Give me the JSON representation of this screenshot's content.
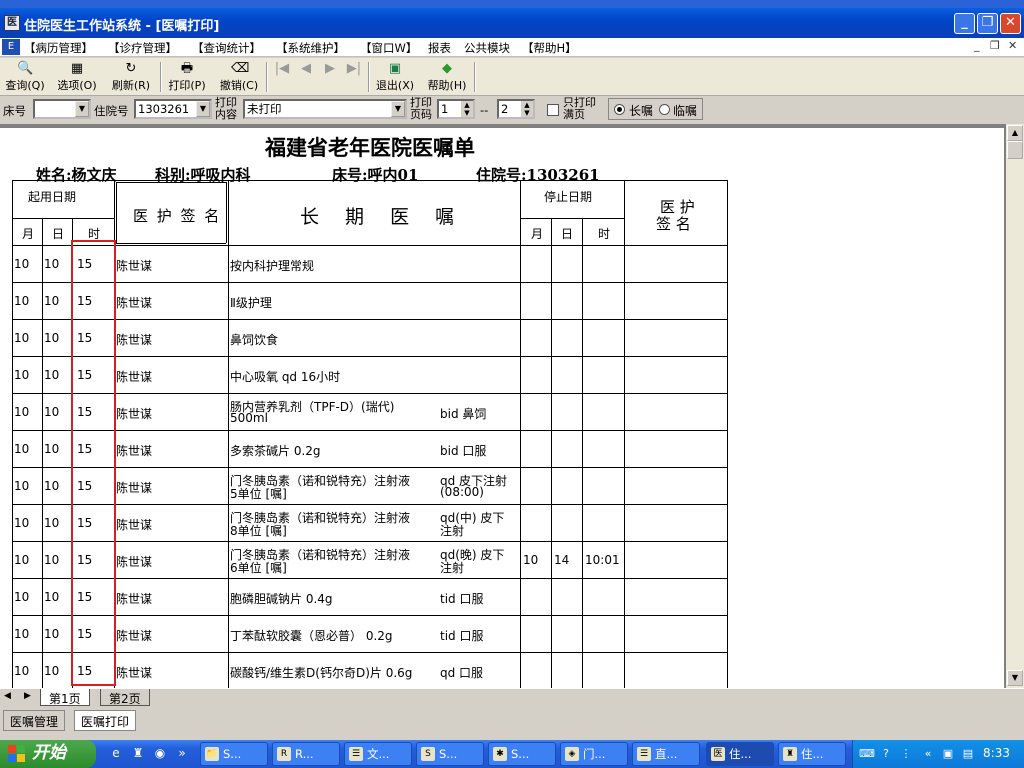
{
  "window": {
    "title": "住院医生工作站系统 - [医嘱打印]",
    "app_icon": "医"
  },
  "window_controls": {
    "minimize": "_",
    "maximize": "❐",
    "close": "✕"
  },
  "menubar": {
    "items": [
      "【病历管理】",
      "【诊疗管理】",
      "【查询统计】",
      "【系统维护】",
      "【窗口W】",
      "报表",
      "公共模块",
      "【帮助H】"
    ],
    "child_controls": [
      "_",
      "❐",
      "✕"
    ]
  },
  "toolbar": {
    "query": "查询(Q)",
    "options": "选项(O)",
    "refresh": "刷新(R)",
    "print": "打印(P)",
    "cancel": "撤销(C)",
    "nav": [
      "|◀",
      "◀",
      "▶",
      "▶|"
    ],
    "exit": "退出(X)",
    "help": "帮助(H)"
  },
  "filter": {
    "bed_label": "床号",
    "bed_value": "",
    "admission_label": "住院号",
    "admission_value": "1303261",
    "print_content_label": "打印内容",
    "print_content_value": "未打印",
    "print_page_label": "打印页码",
    "page_from": "1",
    "page_sep": "--",
    "page_to": "2",
    "only_full_label": "只打印满页",
    "radio_long": "长嘱",
    "radio_temp": "临嘱",
    "radio_selected": "long"
  },
  "document": {
    "title": "福建省老年医院医嘱单",
    "name": "姓名:杨文庆",
    "dept": "科别:呼吸内科",
    "bed": "床号:呼内01",
    "admission": "住院号:1303261",
    "header": {
      "start_date": "起用日期",
      "month": "月",
      "day": "日",
      "hour": "时",
      "signer": "医 护 签 名",
      "order": "长 期 医 嘱",
      "stop_date": "停止日期",
      "stop_month": "月",
      "stop_day": "日",
      "stop_time": "时",
      "stop_signer1": "医 护",
      "stop_signer2": "签 名"
    },
    "rows": [
      {
        "m": "10",
        "d": "10",
        "h": "15",
        "sig": "陈世谋",
        "order": "按内科护理常规",
        "order2": "",
        "freq": "",
        "freq2": "",
        "sm": "",
        "sd": "",
        "st": ""
      },
      {
        "m": "10",
        "d": "10",
        "h": "15",
        "sig": "陈世谋",
        "order": "Ⅱ级护理",
        "order2": "",
        "freq": "",
        "freq2": "",
        "sm": "",
        "sd": "",
        "st": ""
      },
      {
        "m": "10",
        "d": "10",
        "h": "15",
        "sig": "陈世谋",
        "order": "鼻饲饮食",
        "order2": "",
        "freq": "",
        "freq2": "",
        "sm": "",
        "sd": "",
        "st": ""
      },
      {
        "m": "10",
        "d": "10",
        "h": "15",
        "sig": "陈世谋",
        "order": "中心吸氧  qd 16小时",
        "order2": "",
        "freq": "",
        "freq2": "",
        "sm": "",
        "sd": "",
        "st": ""
      },
      {
        "m": "10",
        "d": "10",
        "h": "15",
        "sig": "陈世谋",
        "order": "肠内营养乳剂（TPF-D）(瑞代)",
        "order2": "500ml",
        "freq": "bid 鼻饲",
        "freq2": "",
        "sm": "",
        "sd": "",
        "st": ""
      },
      {
        "m": "10",
        "d": "10",
        "h": "15",
        "sig": "陈世谋",
        "order": "多索茶碱片 0.2g",
        "order2": "",
        "freq": "bid 口服",
        "freq2": "",
        "sm": "",
        "sd": "",
        "st": ""
      },
      {
        "m": "10",
        "d": "10",
        "h": "15",
        "sig": "陈世谋",
        "order": "门冬胰岛素（诺和锐特充）注射液",
        "order2": "5单位  [嘱]",
        "freq": "qd 皮下注射",
        "freq2": "(08:00)",
        "sm": "",
        "sd": "",
        "st": ""
      },
      {
        "m": "10",
        "d": "10",
        "h": "15",
        "sig": "陈世谋",
        "order": "门冬胰岛素（诺和锐特充）注射液",
        "order2": "8单位  [嘱]",
        "freq": "qd(中) 皮下",
        "freq2": "注射",
        "sm": "",
        "sd": "",
        "st": ""
      },
      {
        "m": "10",
        "d": "10",
        "h": "15",
        "sig": "陈世谋",
        "order": "门冬胰岛素（诺和锐特充）注射液",
        "order2": "6单位  [嘱]",
        "freq": "qd(晚) 皮下",
        "freq2": "注射",
        "sm": "10",
        "sd": "14",
        "st": "10:01"
      },
      {
        "m": "10",
        "d": "10",
        "h": "15",
        "sig": "陈世谋",
        "order": "胞磷胆碱钠片 0.4g",
        "order2": "",
        "freq": "tid 口服",
        "freq2": "",
        "sm": "",
        "sd": "",
        "st": ""
      },
      {
        "m": "10",
        "d": "10",
        "h": "15",
        "sig": "陈世谋",
        "order": "丁苯酞软胶囊（恩必普） 0.2g",
        "order2": "",
        "freq": "tid 口服",
        "freq2": "",
        "sm": "",
        "sd": "",
        "st": ""
      },
      {
        "m": "10",
        "d": "10",
        "h": "15",
        "sig": "陈世谋",
        "order": "碳酸钙/维生素D(钙尔奇D)片 0.6g",
        "order2": "",
        "freq": "qd 口服",
        "freq2": "",
        "sm": "",
        "sd": "",
        "st": ""
      }
    ]
  },
  "tabs": {
    "page1": "第1页",
    "page2": "第2页"
  },
  "status": {
    "tab1": "医嘱管理",
    "tab2": "医嘱打印"
  },
  "taskbar": {
    "start": "开始",
    "tasks": [
      "S...",
      "R...",
      "文...",
      "S...",
      "S...",
      "门...",
      "直...",
      "住...",
      "住..."
    ],
    "clock": "8:33"
  }
}
